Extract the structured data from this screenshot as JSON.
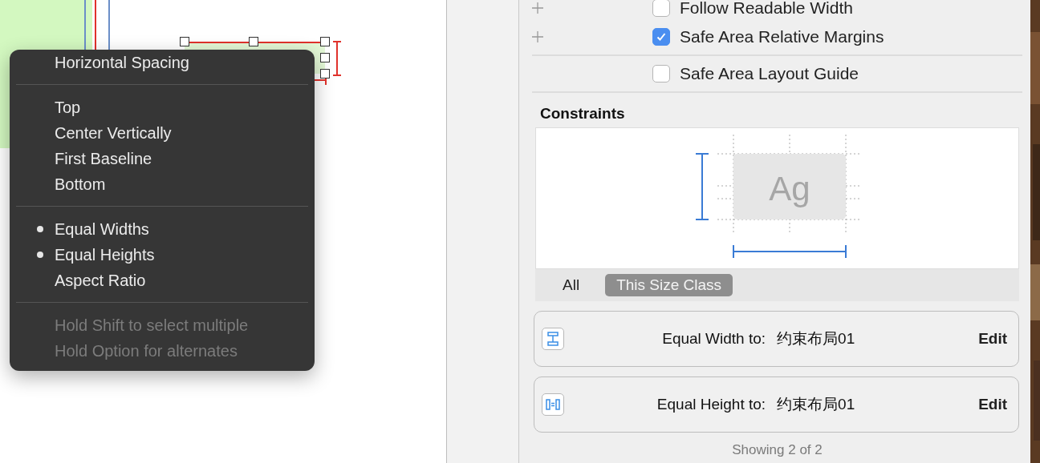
{
  "canvas": {
    "labels": [
      {
        "selected": false
      },
      {
        "selected": true
      }
    ]
  },
  "menu": {
    "sections": [
      [
        {
          "kind": "item",
          "label": "Horizontal Spacing",
          "checked": false
        }
      ],
      [
        {
          "kind": "item",
          "label": "Top",
          "checked": false
        },
        {
          "kind": "item",
          "label": "Center Vertically",
          "checked": false
        },
        {
          "kind": "item",
          "label": "First Baseline",
          "checked": false
        },
        {
          "kind": "item",
          "label": "Bottom",
          "checked": false
        }
      ],
      [
        {
          "kind": "item",
          "label": "Equal Widths",
          "checked": true
        },
        {
          "kind": "item",
          "label": "Equal Heights",
          "checked": true
        },
        {
          "kind": "item",
          "label": "Aspect Ratio",
          "checked": false
        }
      ],
      [
        {
          "kind": "hint",
          "label": "Hold Shift to select multiple"
        },
        {
          "kind": "hint",
          "label": "Hold Option for alternates"
        }
      ]
    ]
  },
  "inspector": {
    "options": [
      {
        "label": "Follow Readable Width",
        "checked": false,
        "plus": true
      },
      {
        "label": "Safe Area Relative Margins",
        "checked": true,
        "plus": true
      },
      {
        "label": "Safe Area Layout Guide",
        "checked": false,
        "plus": false
      }
    ],
    "constraints": {
      "title": "Constraints",
      "preview_text": "Ag",
      "tabs": [
        {
          "label": "All",
          "selected": false
        },
        {
          "label": "This Size Class",
          "selected": true
        }
      ],
      "items": [
        {
          "kind": "width",
          "label": "Equal Width to:",
          "target": "约束布局01",
          "action": "Edit"
        },
        {
          "kind": "height",
          "label": "Equal Height to:",
          "target": "约束布局01",
          "action": "Edit"
        }
      ],
      "footer": "Showing 2 of 2"
    }
  }
}
